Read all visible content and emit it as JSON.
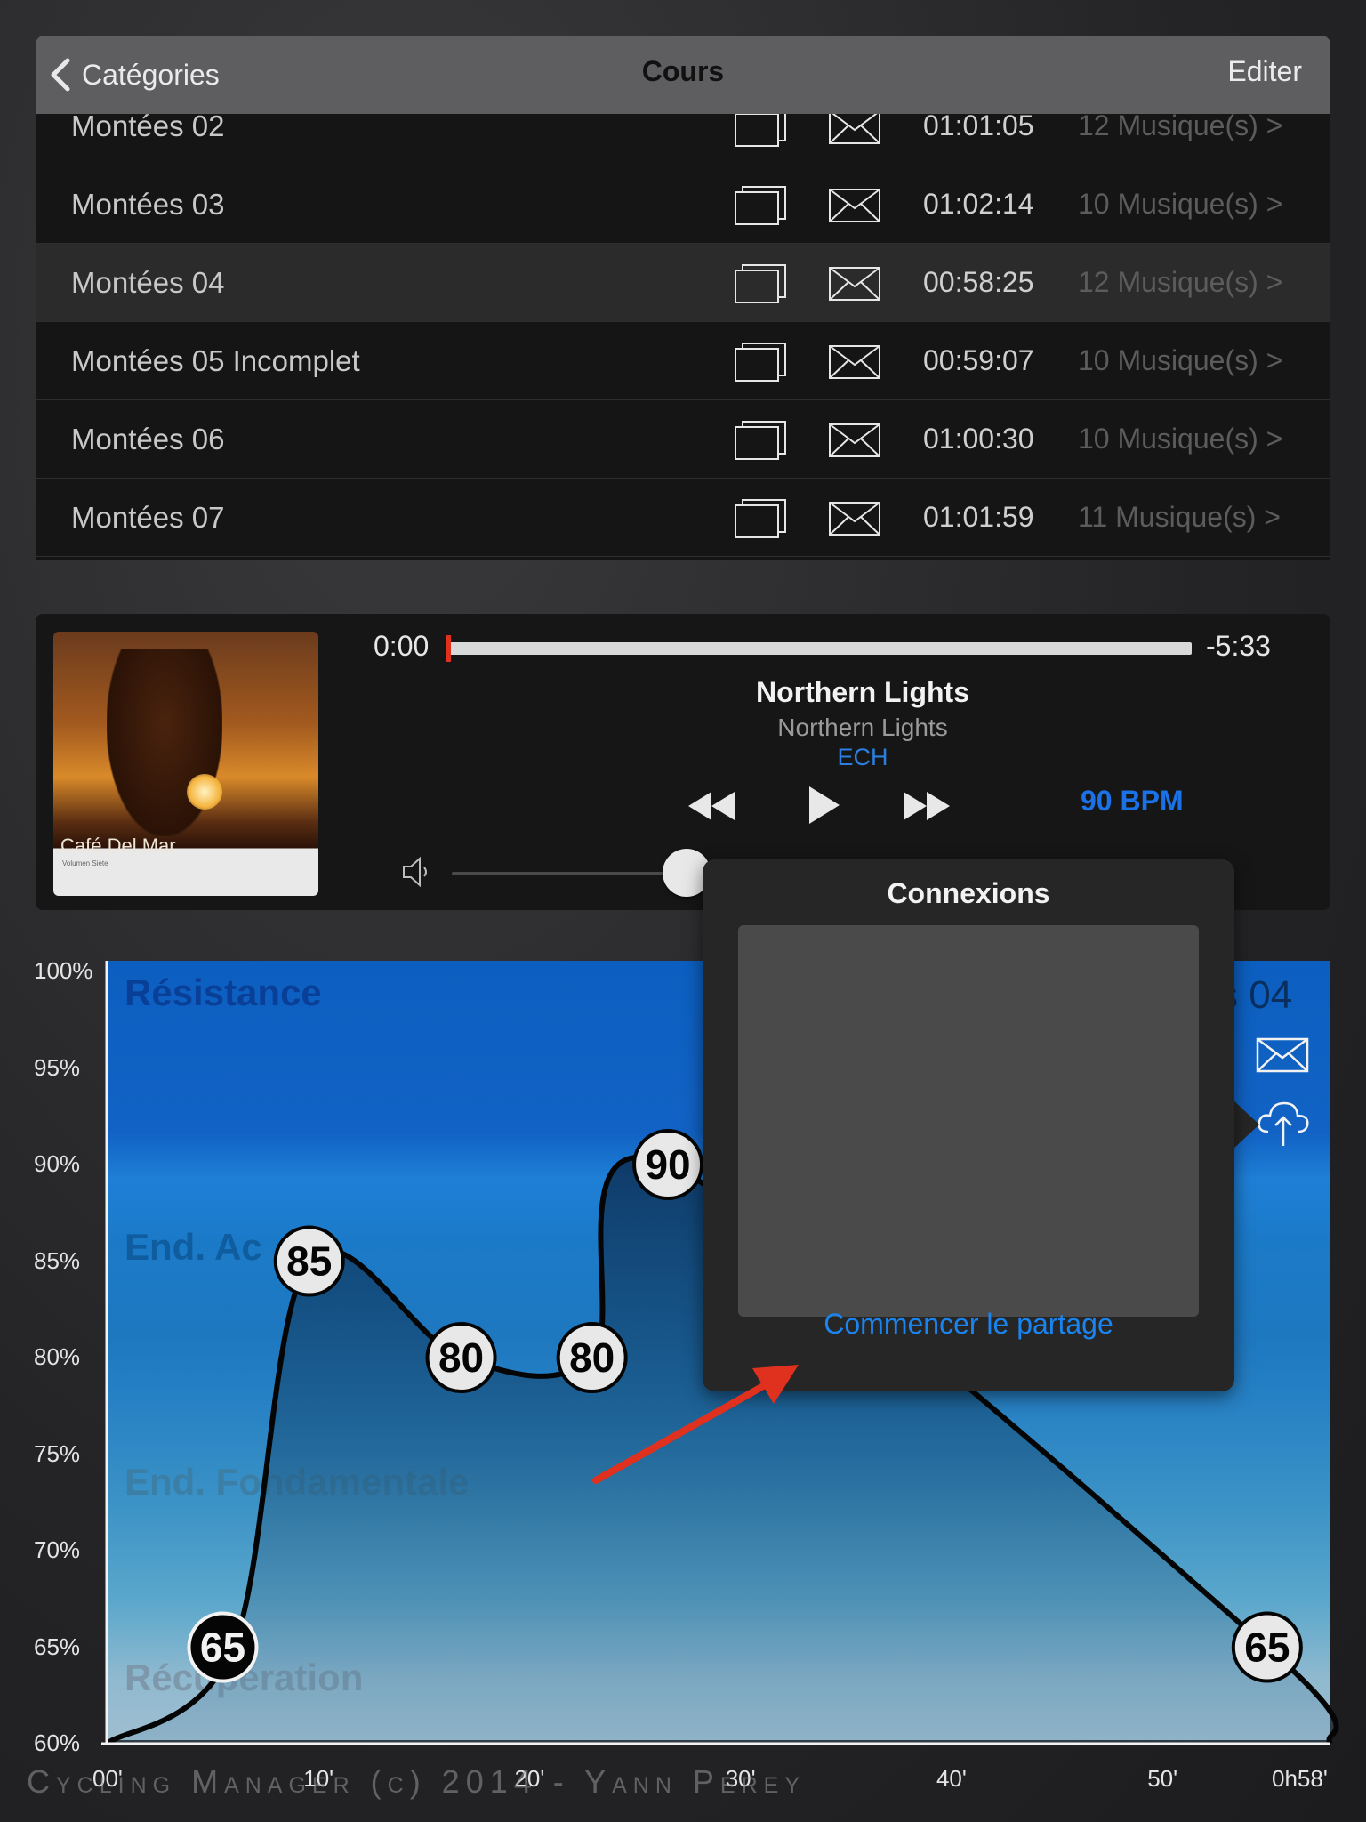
{
  "nav": {
    "back_label": "Catégories",
    "title": "Cours",
    "edit_label": "Editer"
  },
  "courses": [
    {
      "name": "Montées 02",
      "duration": "01:01:05",
      "tracks": "12 Musique(s) >"
    },
    {
      "name": "Montées 03",
      "duration": "01:02:14",
      "tracks": "10 Musique(s) >"
    },
    {
      "name": "Montées 04",
      "duration": "00:58:25",
      "tracks": "12 Musique(s) >",
      "selected": true
    },
    {
      "name": "Montées 05 Incomplet",
      "duration": "00:59:07",
      "tracks": "10 Musique(s) >"
    },
    {
      "name": "Montées 06",
      "duration": "01:00:30",
      "tracks": "10 Musique(s) >"
    },
    {
      "name": "Montées 07",
      "duration": "01:01:59",
      "tracks": "11 Musique(s) >"
    }
  ],
  "player": {
    "elapsed": "0:00",
    "remaining": "-5:33",
    "progress": 0.0,
    "volume": 0.75,
    "track_title": "Northern Lights",
    "track_album": "Northern Lights",
    "track_tag": "ECH",
    "bpm": "90 BPM",
    "album_title": "Café Del Mar",
    "album_subtitle": "Volumen Siete"
  },
  "chart": {
    "course_title": "s 04",
    "zones": [
      "Résistance",
      "End. Ac",
      "End. Fondamentale",
      "Récupération"
    ],
    "watermark": "Cycling Manager (c) 2014 - Yann Perey"
  },
  "chart_data": {
    "type": "area",
    "x_labels": [
      "00'",
      "10'",
      "20'",
      "30'",
      "40'",
      "50'",
      "0h58'"
    ],
    "y_labels": [
      "100%",
      "95%",
      "90%",
      "85%",
      "80%",
      "75%",
      "70%",
      "65%",
      "60%"
    ],
    "ylim": [
      60,
      100
    ],
    "xlim": [
      0,
      58
    ],
    "points": [
      {
        "x": 0,
        "y": 60
      },
      {
        "x": 6,
        "y": 65
      },
      {
        "x": 9.6,
        "y": 85
      },
      {
        "x": 16.8,
        "y": 80
      },
      {
        "x": 23,
        "y": 80
      },
      {
        "x": 26.6,
        "y": 90
      },
      {
        "x": 55,
        "y": 65
      },
      {
        "x": 58,
        "y": 60
      }
    ],
    "markers": [
      {
        "x": 5.5,
        "y": 65,
        "label": "65",
        "style": "dark"
      },
      {
        "x": 9.6,
        "y": 85,
        "label": "85",
        "style": "light"
      },
      {
        "x": 16.8,
        "y": 80,
        "label": "80",
        "style": "light"
      },
      {
        "x": 23,
        "y": 80,
        "label": "80",
        "style": "light"
      },
      {
        "x": 26.6,
        "y": 90,
        "label": "90",
        "style": "light"
      },
      {
        "x": 55,
        "y": 65,
        "label": "65",
        "style": "light"
      }
    ]
  },
  "popover": {
    "title": "Connexions",
    "action": "Commencer le partage"
  },
  "icons": {
    "back": "chevron-left-icon",
    "copy": "copy-icon",
    "mail": "mail-icon",
    "rewind": "rewind-icon",
    "play": "play-icon",
    "forward": "fast-forward-icon",
    "volume": "speaker-icon",
    "cloud": "cloud-upload-icon"
  },
  "colors": {
    "accent": "#1a84f0",
    "bpm": "#1a72e6",
    "progress_head": "#e0301e",
    "arrow": "#e0301e"
  }
}
